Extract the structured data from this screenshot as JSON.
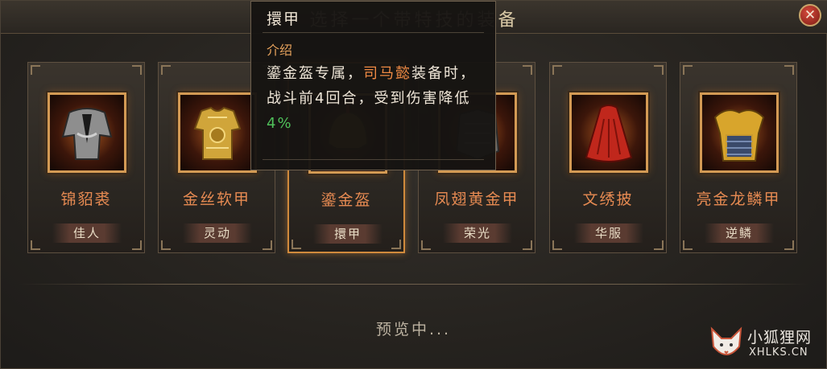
{
  "dialog": {
    "title": "选择一个带特技的装备",
    "close_symbol": "✕"
  },
  "items": [
    {
      "name": "锦貂裘",
      "tag": "佳人",
      "icon": "fur-robe-icon"
    },
    {
      "name": "金丝软甲",
      "tag": "灵动",
      "icon": "golden-soft-armor-icon"
    },
    {
      "name": "鎏金盔",
      "tag": "擐甲",
      "icon": "gilded-helmet-icon",
      "selected": true
    },
    {
      "name": "凤翅黄金甲",
      "tag": "荣光",
      "icon": "phoenix-armor-icon"
    },
    {
      "name": "文绣披",
      "tag": "华服",
      "icon": "red-cape-icon"
    },
    {
      "name": "亮金龙鳞甲",
      "tag": "逆鳞",
      "icon": "dragon-scale-armor-icon"
    }
  ],
  "tooltip": {
    "title": "擐甲",
    "intro_label": "介绍",
    "desc_part1": "鎏金盔专属，",
    "desc_highlight": "司马懿",
    "desc_part2": "装备时，战斗前4回合，受到伤害降低",
    "desc_value": "4%"
  },
  "status": {
    "preview_text": "预览中..."
  },
  "watermark": {
    "cn": "小狐狸网",
    "en": "XHLKS.CN"
  }
}
